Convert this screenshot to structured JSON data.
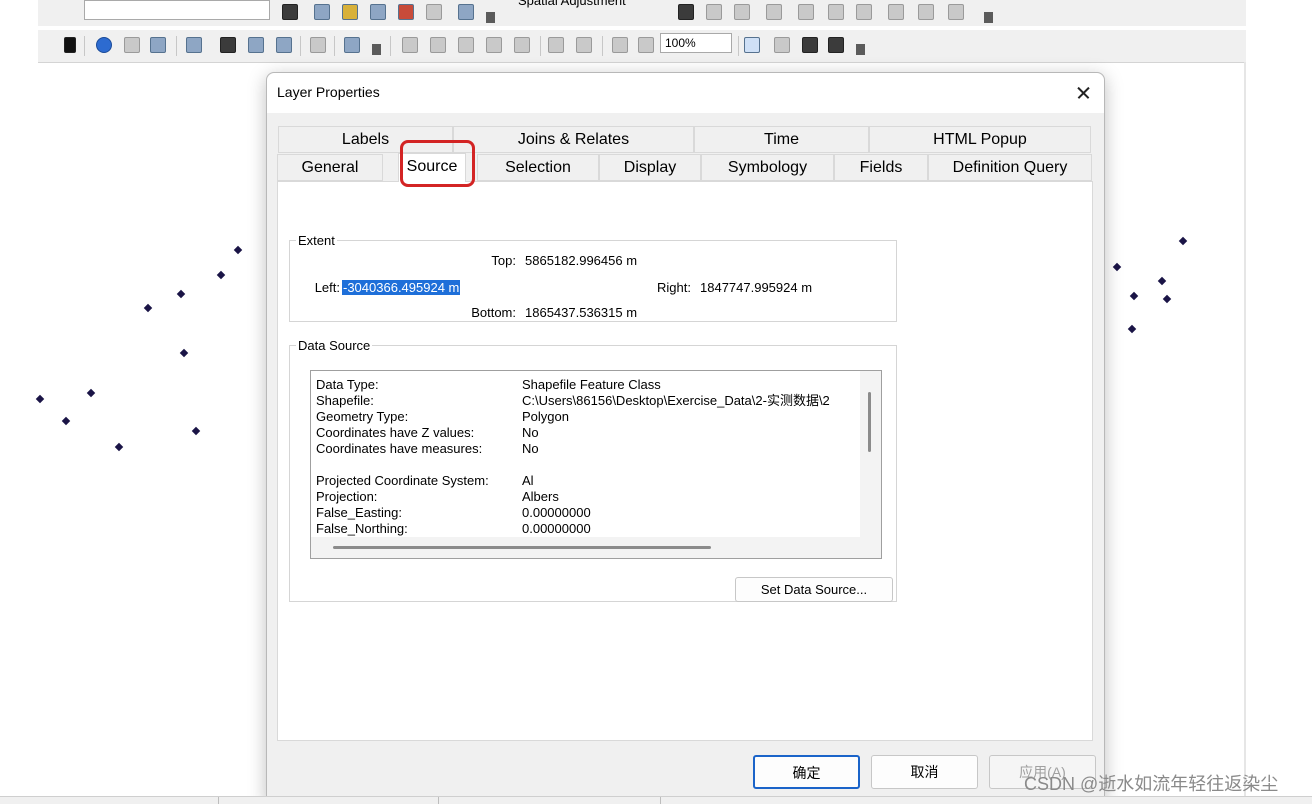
{
  "toolbar": {
    "spatial_adjustment_label": "Spatial Adjustment",
    "zoom_level": "100%",
    "icons": [
      "select-arrow-icon",
      "identify-icon",
      "hyperlink-icon",
      "html-popup-icon",
      "measure-icon",
      "find-icon",
      "go-to-xy-icon",
      "xy-icon",
      "time-slider-icon",
      "create-viewer-icon",
      "zoom-in-icon",
      "zoom-out-icon",
      "pan-icon",
      "full-extent-icon",
      "fixed-zoom-icon",
      "previous-extent-icon",
      "next-extent-icon",
      "toggle-draft-icon",
      "focus-frame-icon",
      "change-layout-icon",
      "data-driven-pages-icon"
    ]
  },
  "dialog": {
    "title": "Layer Properties",
    "tabs_row1": [
      "Labels",
      "Joins & Relates",
      "Time",
      "HTML Popup"
    ],
    "tabs_row2": [
      "General",
      "Source",
      "Selection",
      "Display",
      "Symbology",
      "Fields",
      "Definition Query"
    ],
    "active_tab": "Source",
    "extent": {
      "legend": "Extent",
      "top_label": "Top:",
      "top_value": "5865182.996456 m",
      "left_label": "Left:",
      "left_value": "-3040366.495924 m",
      "right_label": "Right:",
      "right_value": "1847747.995924 m",
      "bottom_label": "Bottom:",
      "bottom_value": "1865437.536315 m"
    },
    "data_source": {
      "legend": "Data Source",
      "rows": [
        {
          "key": "Data Type:",
          "value": "Shapefile Feature Class"
        },
        {
          "key": "Shapefile:",
          "value": "C:\\Users\\86156\\Desktop\\Exercise_Data\\2-实测数据\\2"
        },
        {
          "key": "Geometry Type:",
          "value": "Polygon"
        },
        {
          "key": "Coordinates have Z values:",
          "value": "No"
        },
        {
          "key": "Coordinates have measures:",
          "value": "No"
        },
        {
          "key": "",
          "value": ""
        },
        {
          "key": "Projected Coordinate System:",
          "value": "Al"
        },
        {
          "key": "Projection:",
          "value": "Albers"
        },
        {
          "key": "False_Easting:",
          "value": "0.00000000"
        },
        {
          "key": "False_Northing:",
          "value": "0.00000000"
        }
      ],
      "set_button": "Set Data Source..."
    },
    "ok_button": "确定",
    "cancel_button": "取消",
    "apply_button": "应用(A)"
  },
  "watermark": "CSDN @逝水如流年轻往返染尘",
  "colors": {
    "highlight_ring": "#d32424",
    "selection_bg": "#1e6fd9",
    "map_point": "#1a1446",
    "ok_border": "#1b64c9"
  }
}
